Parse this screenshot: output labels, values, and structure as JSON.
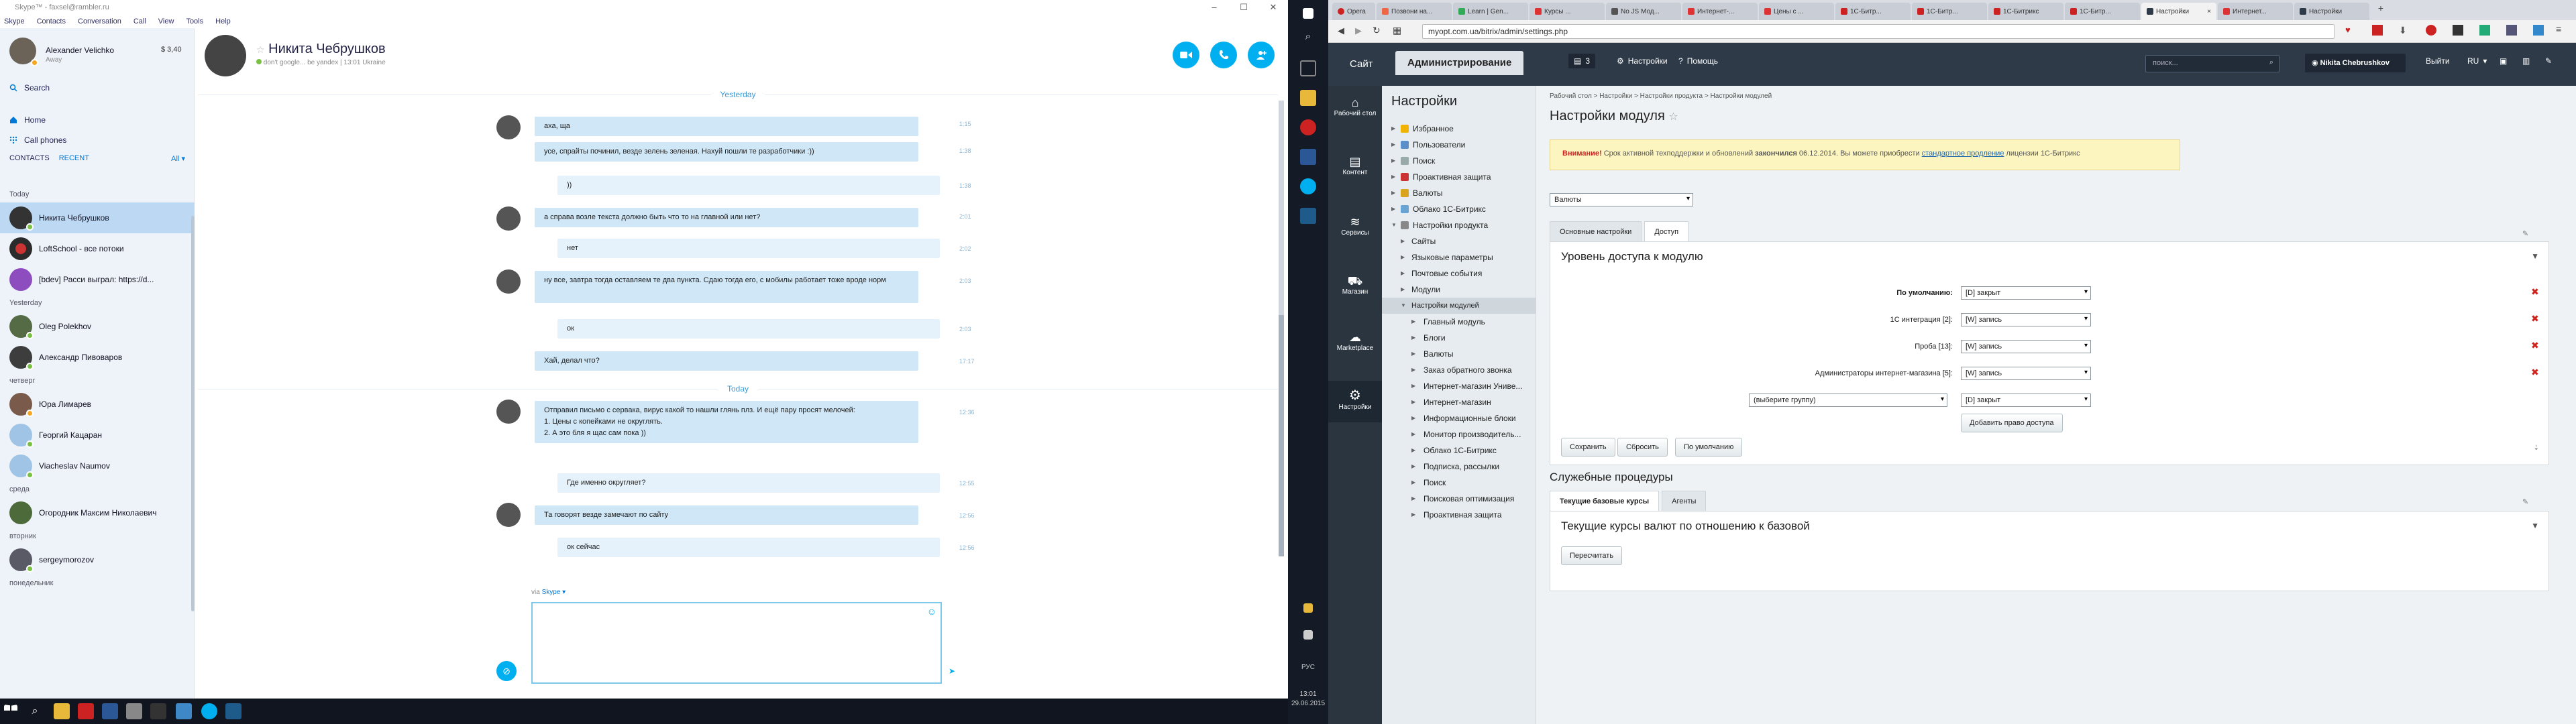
{
  "skype": {
    "title": "Skype™ - faxsel@rambler.ru",
    "menu": [
      "Skype",
      "Contacts",
      "Conversation",
      "Call",
      "View",
      "Tools",
      "Help"
    ],
    "user": {
      "name": "Alexander Velichko",
      "status": "Away",
      "credit": "$ 3,40"
    },
    "search_label": "Search",
    "home_label": "Home",
    "call_phones_label": "Call phones",
    "contacts_tab": "CONTACTS",
    "recent_tab": "RECENT",
    "filter_label": "All",
    "sections": {
      "today": "Today",
      "yesterday": "Yesterday",
      "thursday": "четверг",
      "wednesday": "среда",
      "tuesday": "вторник",
      "monday": "понедельник"
    },
    "contacts": [
      {
        "name": "Никита Чебрушков",
        "section": "today"
      },
      {
        "name": "LoftSchool - все потоки",
        "section": "today"
      },
      {
        "name": "[bdev] Расси выграл: https://d...",
        "section": "today"
      },
      {
        "name": "Oleg Polekhov",
        "section": "yesterday"
      },
      {
        "name": "Александр Пивоваров",
        "section": "yesterday"
      },
      {
        "name": "Юра Лимарев",
        "section": "thursday"
      },
      {
        "name": "Георгий Кацаран",
        "section": "thursday"
      },
      {
        "name": "Viacheslav Naumov",
        "section": "thursday"
      },
      {
        "name": "Огородник Максим Николаевич",
        "section": "wednesday"
      },
      {
        "name": "sergeymorozov",
        "section": "tuesday"
      }
    ],
    "conversation": {
      "name": "Никита Чебрушков",
      "mood": "don't google... be yandex",
      "location": "| 13:01 Ukraine",
      "day_yesterday": "Yesterday",
      "day_today": "Today",
      "messages": [
        {
          "text": "аха, ща",
          "time": "1:15"
        },
        {
          "text": "усе, спрайты починил, везде зелень зеленая. Нахуй пошли те разработчики :))",
          "time": "1:38"
        },
        {
          "text": "))",
          "time": "1:38"
        },
        {
          "text": "а справа возле текста должно быть что то на главной или нет?",
          "time": "2:01"
        },
        {
          "text": "нет",
          "time": "2:02"
        },
        {
          "text": "ну все, завтра тогда оставляем те два пункта. Сдаю тогда его, с мобилы работает тоже вроде норм",
          "time": "2:03"
        },
        {
          "text": "ок",
          "time": "2:03"
        },
        {
          "text": "Хай, делал что?",
          "time": "17:17"
        },
        {
          "text_lines": [
            "Отправил письмо с сервака, вирус какой то нашли глянь плз. И ещё пару просят мелочей:",
            "1. Цены с копейками не округлять.",
            "2. А это бля я щас сам пока ))"
          ],
          "time": "12:36"
        },
        {
          "text": "Где именно округляет?",
          "time": "12:55"
        },
        {
          "text": "Та говорят везде замечают по сайту",
          "time": "12:56"
        },
        {
          "text": "ок сейчас",
          "time": "12:56"
        }
      ],
      "via_label": "via",
      "via_service": "Skype"
    }
  },
  "vertical_taskbar": {
    "lang": "РУС",
    "time": "13:01",
    "date": "29.06.2015"
  },
  "browser": {
    "tabs": [
      "Opera",
      "Позвони на...",
      "Learn | Gen...",
      "Курсы ...",
      "No JS Мод...",
      "Интернет-...",
      "Цены с ...",
      "1С-Битр...",
      "1С-Битр...",
      "1С-Битрикс",
      "1С-Битр...",
      "Настройки",
      "Интернет...",
      "Настройки"
    ],
    "url": "myopt.com.ua/bitrix/admin/settings.php",
    "bitrix": {
      "site_tab": "Сайт",
      "admin_tab": "Администрирование",
      "counter": "3",
      "settings_btn": "Настройки",
      "help_btn": "Помощь",
      "search_placeholder": "поиск...",
      "user": "Nikita Chebrushkov",
      "logout": "Выйти",
      "lang": "RU",
      "iconbar": [
        "Рабочий стол",
        "Контент",
        "Сервисы",
        "Магазин",
        "Marketplace",
        "Настройки"
      ],
      "menu_title": "Настройки",
      "menu": [
        "Избранное",
        "Пользователи",
        "Поиск",
        "Проактивная защита",
        "Валюты",
        "Облако 1С-Битрикс",
        "Настройки продукта",
        "Сайты",
        "Языковые параметры",
        "Почтовые события",
        "Модули",
        "Настройки модулей",
        "Главный модуль",
        "Блоги",
        "Валюты",
        "Заказ обратного звонка",
        "Интернет-магазин Униве...",
        "Интернет-магазин",
        "Информационные блоки",
        "Монитор производитель...",
        "Облако 1С-Битрикс",
        "Подписка, рассылки",
        "Поиск",
        "Поисковая оптимизация",
        "Проактивная защита"
      ],
      "breadcrumbs": [
        "Рабочий стол",
        "Настройки",
        "Настройки продукта",
        "Настройки модулей"
      ],
      "page_title": "Настройки модуля",
      "warning_bold": "Внимание!",
      "warning_text": " Срок активной техподдержки и обновлений ",
      "warning_ends": "закончился",
      "warning_date": " 06.12.2014. Вы можете приобрести ",
      "warning_link": "стандартное продление",
      "warning_tail": " лицензии 1С-Битрикс",
      "module_select": "Валюты",
      "tab_main": "Основные настройки",
      "tab_access": "Доступ",
      "panel_title": "Уровень доступа к модулю",
      "rows": [
        {
          "label": "По умолчанию:",
          "value": "[D] закрыт"
        },
        {
          "label": "1С интеграция [2]:",
          "value": "[W] запись"
        },
        {
          "label": "Проба [13]:",
          "value": "[W] запись"
        },
        {
          "label": "Администраторы интернет-магазина [5]:",
          "value": "[W] запись"
        }
      ],
      "group_select": "(выберите группу)",
      "new_value": "[D] закрыт",
      "add_access_btn": "Добавить право доступа",
      "save_btn": "Сохранить",
      "reset_btn": "Сбросить",
      "default_btn": "По умолчанию",
      "service_title": "Служебные процедуры",
      "stab_rates": "Текущие базовые курсы",
      "stab_agents": "Агенты",
      "rates_title": "Текущие курсы валют по отношению к базовой",
      "recalc_btn": "Пересчитать"
    }
  }
}
